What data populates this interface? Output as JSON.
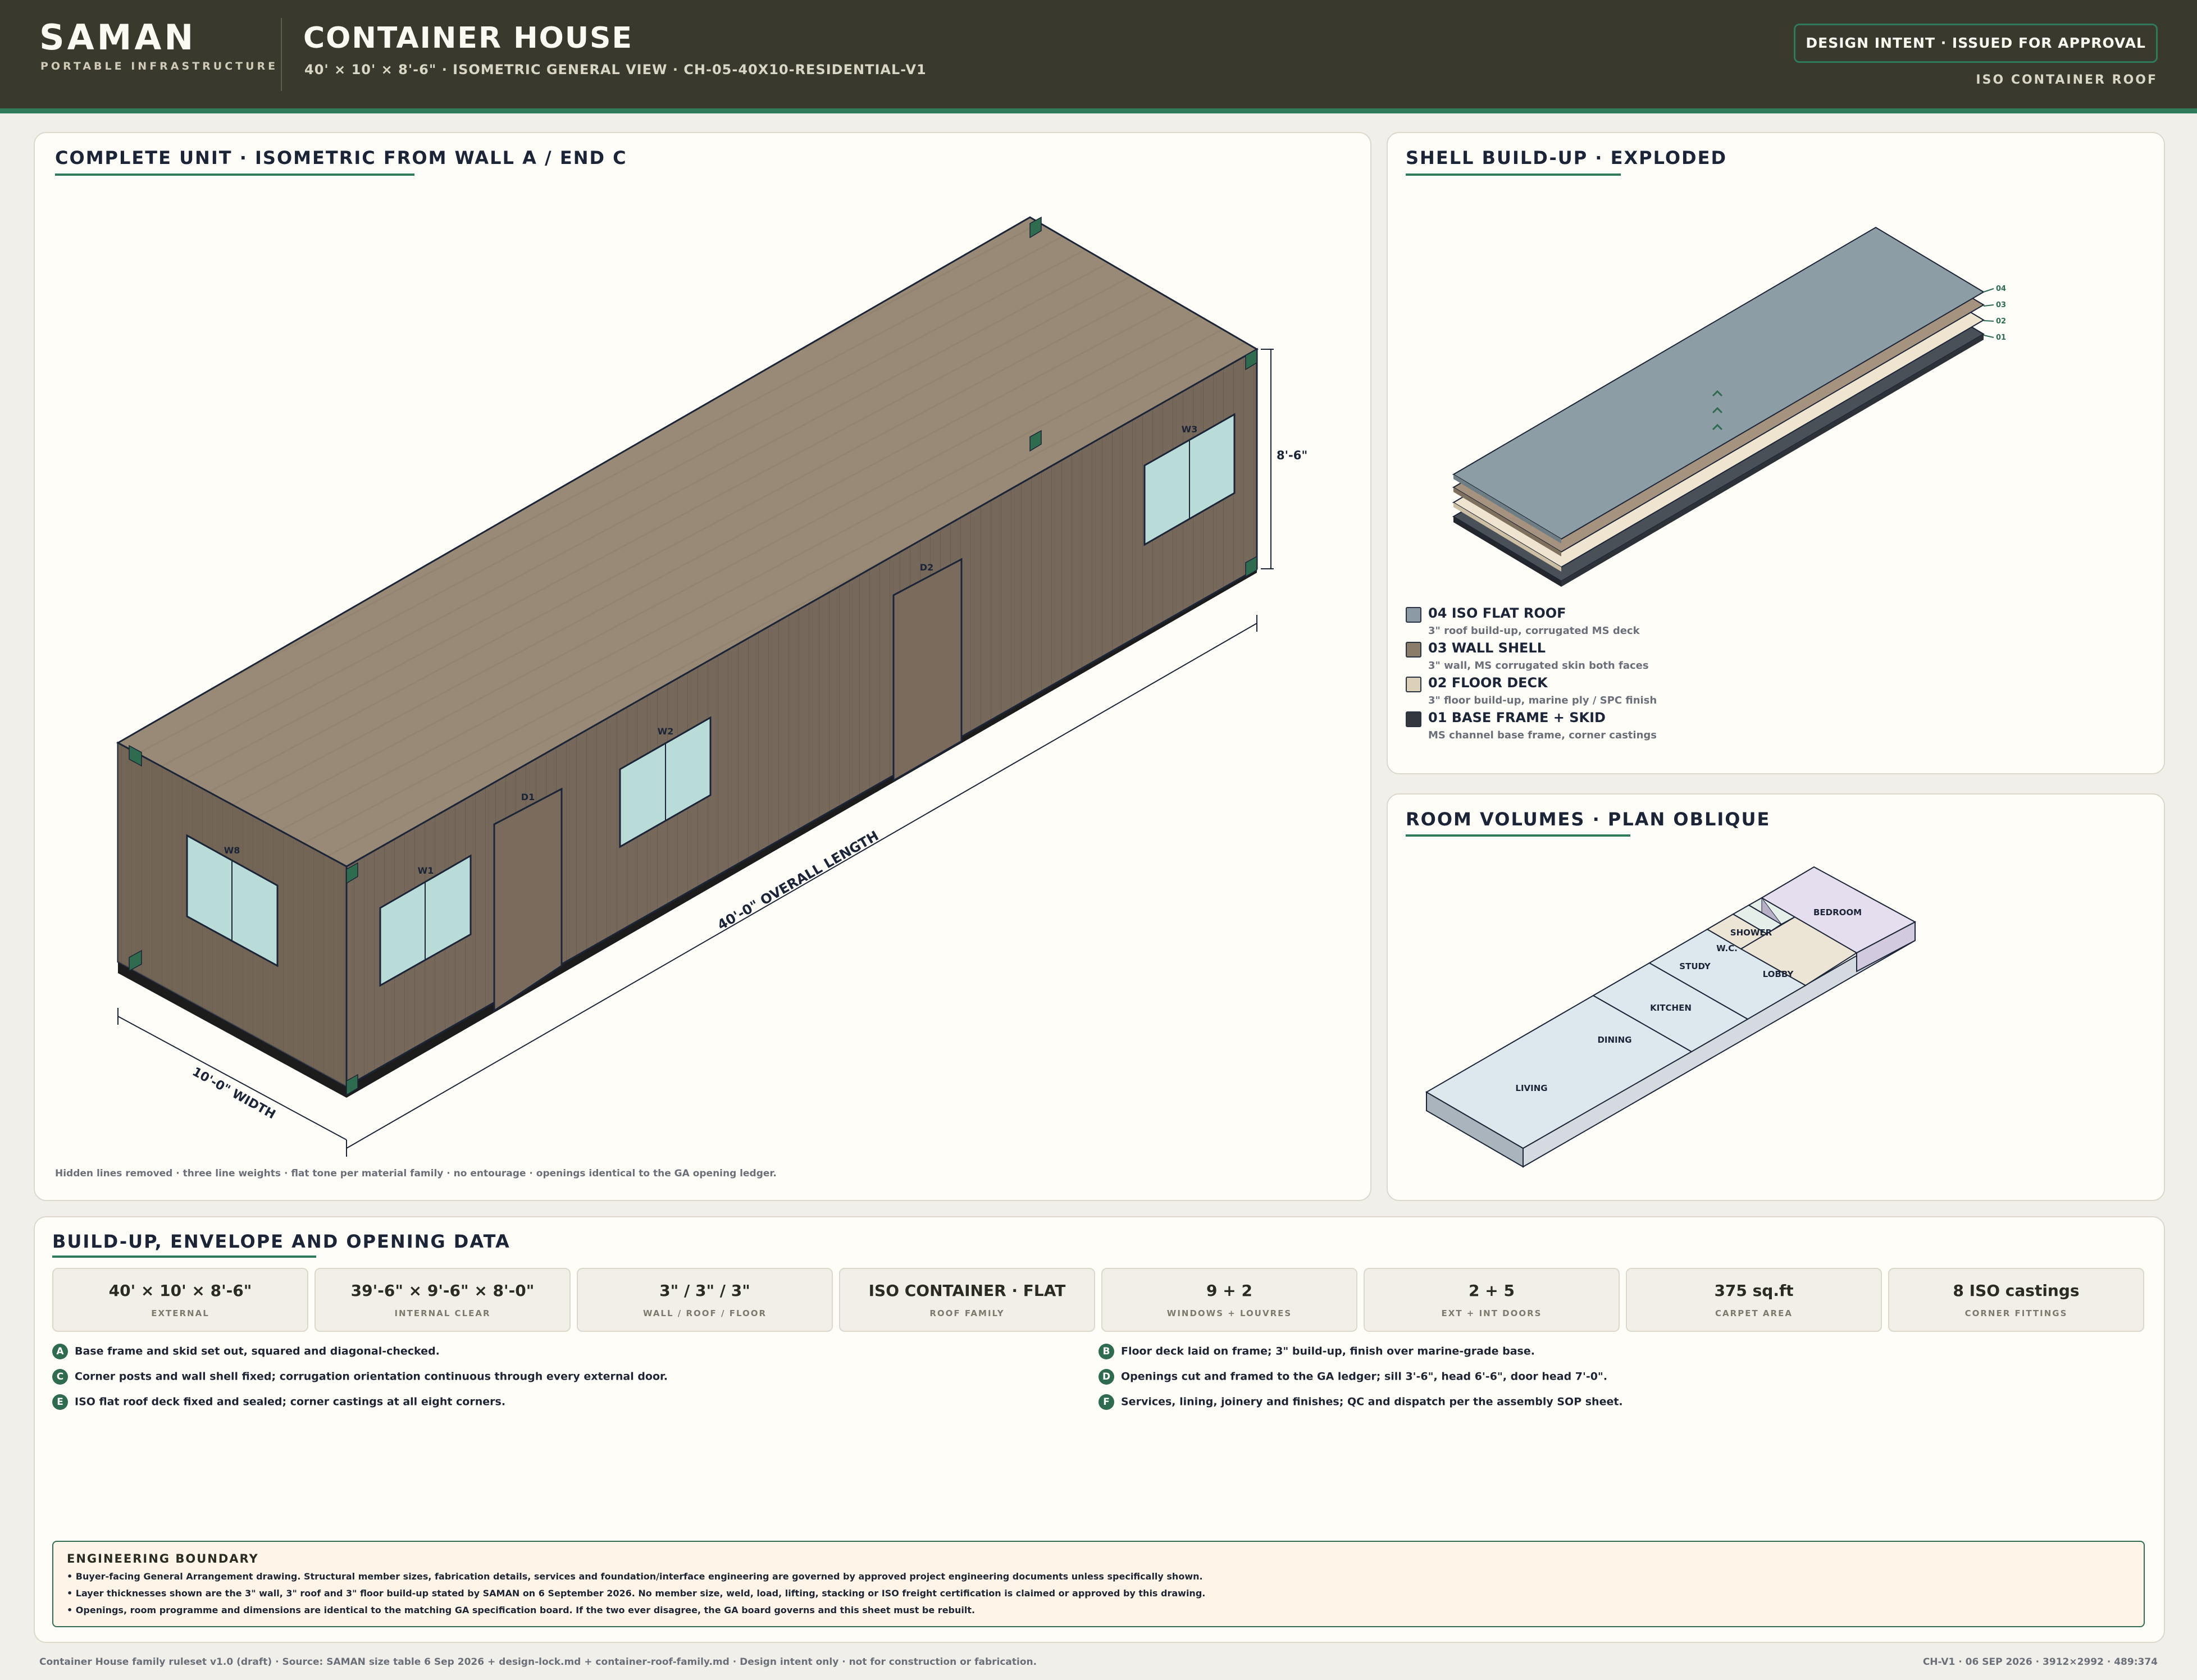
{
  "header": {
    "brand": "SAMAN",
    "brand_sub": "PORTABLE INFRASTRUCTURE",
    "title": "CONTAINER HOUSE",
    "subtitle": "40' × 10' × 8'-6\" · ISOMETRIC GENERAL VIEW · CH-05-40X10-RESIDENTIAL-V1",
    "status": "DESIGN INTENT · ISSUED FOR APPROVAL",
    "roof_tag": "ISO CONTAINER ROOF"
  },
  "iso_view": {
    "title": "COMPLETE UNIT · ISOMETRIC FROM WALL A / END C",
    "openings": [
      "W1",
      "D1",
      "W2",
      "D2",
      "W3",
      "W8"
    ],
    "dim_height": "8'-6\"",
    "dim_length": "40'-0\" OVERALL LENGTH",
    "dim_width": "10'-0\" WIDTH",
    "footnote": "Hidden lines removed · three line weights · flat tone per material family · no entourage · openings identical to the GA opening ledger."
  },
  "shell": {
    "title": "SHELL BUILD-UP · EXPLODED",
    "tags": [
      "04",
      "03",
      "02",
      "01"
    ],
    "layers": [
      {
        "title": "04 ISO FLAT ROOF",
        "sub": "3\" roof build-up, corrugated MS deck",
        "color": "#8c9ba3"
      },
      {
        "title": "03 WALL SHELL",
        "sub": "3\" wall, MS corrugated skin both faces",
        "color": "#8b7b69"
      },
      {
        "title": "02 FLOOR DECK",
        "sub": "3\" floor build-up, marine ply / SPC finish",
        "color": "#dcd0b9"
      },
      {
        "title": "01 BASE FRAME + SKID",
        "sub": "MS channel base frame, corner castings",
        "color": "#33383f"
      }
    ]
  },
  "rooms": {
    "title": "ROOM VOLUMES · PLAN OBLIQUE",
    "names": [
      "LIVING",
      "DINING",
      "KITCHEN",
      "STUDY",
      "W.C.",
      "SHOWER",
      "LOBBY",
      "BEDROOM"
    ]
  },
  "buildup": {
    "title": "BUILD-UP, ENVELOPE AND OPENING DATA",
    "stats": [
      {
        "value": "40' × 10' × 8'-6\"",
        "label": "EXTERNAL"
      },
      {
        "value": "39'-6\" × 9'-6\" × 8'-0\"",
        "label": "INTERNAL CLEAR"
      },
      {
        "value": "3\" / 3\" / 3\"",
        "label": "WALL / ROOF / FLOOR"
      },
      {
        "value": "ISO CONTAINER · FLAT",
        "label": "ROOF FAMILY"
      },
      {
        "value": "9 + 2",
        "label": "WINDOWS + LOUVRES"
      },
      {
        "value": "2 + 5",
        "label": "EXT + INT DOORS"
      },
      {
        "value": "375 sq.ft",
        "label": "CARPET AREA"
      },
      {
        "value": "8 ISO castings",
        "label": "CORNER FITTINGS"
      }
    ],
    "steps": [
      {
        "badge": "A",
        "text": "Base frame and skid set out, squared and diagonal-checked."
      },
      {
        "badge": "B",
        "text": "Floor deck laid on frame; 3\" build-up, finish over marine-grade base."
      },
      {
        "badge": "C",
        "text": "Corner posts and wall shell fixed; corrugation orientation continuous through every external door."
      },
      {
        "badge": "D",
        "text": "Openings cut and framed to the GA ledger; sill 3'-6\", head 6'-6\", door head 7'-0\"."
      },
      {
        "badge": "E",
        "text": "ISO flat roof deck fixed and sealed; corner castings at all eight corners."
      },
      {
        "badge": "F",
        "text": "Services, lining, joinery and finishes; QC and dispatch per the assembly SOP sheet."
      }
    ],
    "engineering": {
      "title": "ENGINEERING BOUNDARY",
      "lines": [
        "• Buyer-facing General Arrangement drawing. Structural member sizes, fabrication details, services and foundation/interface engineering are governed by approved project engineering documents unless specifically shown.",
        "• Layer thicknesses shown are the 3\" wall, 3\" roof and 3\" floor build-up stated by SAMAN on 6 September 2026. No member size, weld, load, lifting, stacking or ISO freight certification is claimed or approved by this drawing.",
        "• Openings, room programme and dimensions are identical to the matching GA specification board. If the two ever disagree, the GA board governs and this sheet must be rebuilt."
      ]
    }
  },
  "footer": {
    "left": "Container House family ruleset v1.0 (draft) · Source: SAMAN size table 6 Sep 2026 + design-lock.md + container-roof-family.md · Design intent only · not for construction or fabrication.",
    "right": "CH-V1 · 06 SEP 2026 · 3912×2992 · 489:374"
  }
}
